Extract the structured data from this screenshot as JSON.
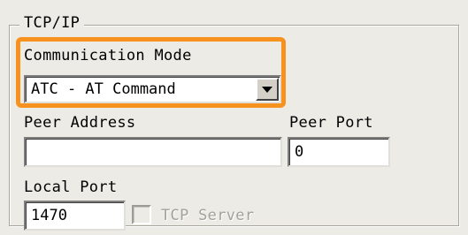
{
  "group": {
    "title": "TCP/IP"
  },
  "communication_mode": {
    "label": "Communication Mode",
    "selected": "ATC - AT Command"
  },
  "peer_address": {
    "label": "Peer Address",
    "value": ""
  },
  "peer_port": {
    "label": "Peer Port",
    "value": "0"
  },
  "local_port": {
    "label": "Local Port",
    "value": "1470"
  },
  "tcp_server": {
    "label": "TCP Server",
    "checked": false,
    "enabled": false
  },
  "colors": {
    "highlight": "#f7921e",
    "background": "#ecebe5"
  }
}
